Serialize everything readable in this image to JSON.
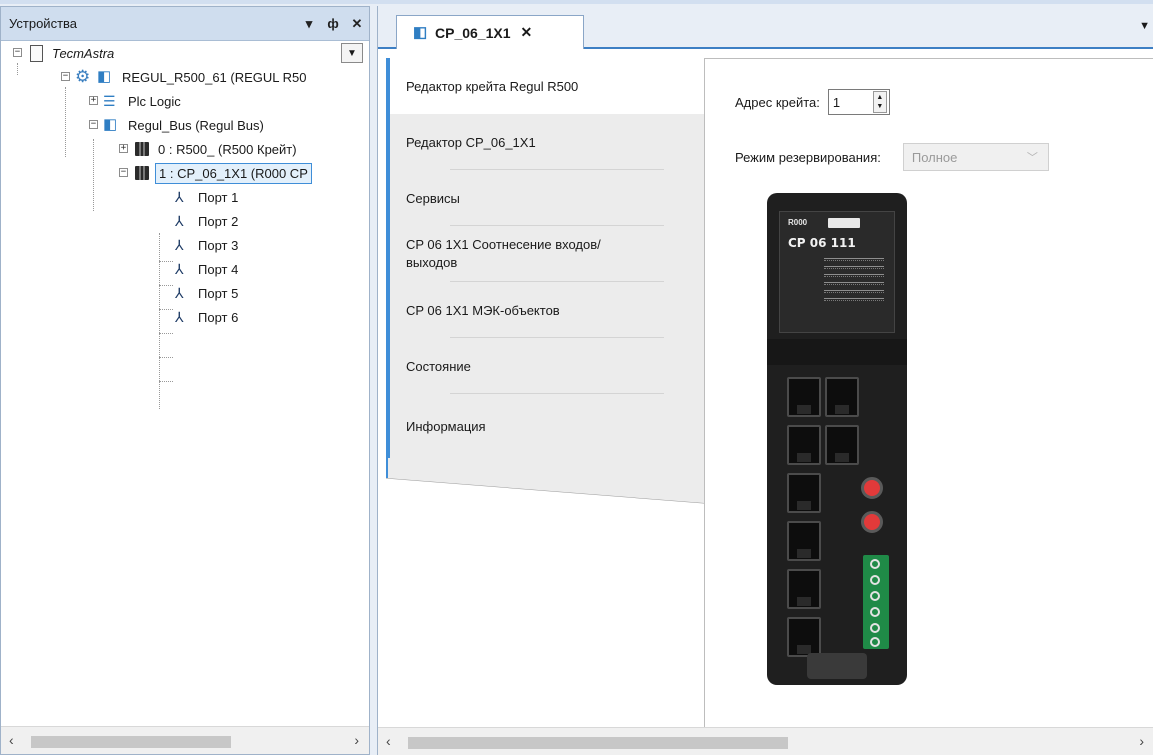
{
  "devices_panel": {
    "title": "Устройства",
    "header_buttons": {
      "dropdown": "▾",
      "pin": "ф",
      "close": "✕"
    },
    "tree": [
      {
        "label": "ТестAstra",
        "expander": "−"
      },
      {
        "label": "REGUL_R500_61 (REGUL R50",
        "expander": "−"
      },
      {
        "label": "Plc Logic",
        "expander": "+"
      },
      {
        "label": "Regul_Bus (Regul Bus)",
        "expander": "−"
      },
      {
        "label": "0 : R500_ (R500 Крейт)",
        "expander": "+"
      },
      {
        "label": "1 : CP_06_1X1 (R000 CP",
        "expander": "−"
      },
      {
        "label": "Порт 1"
      },
      {
        "label": "Порт 2"
      },
      {
        "label": "Порт 3"
      },
      {
        "label": "Порт 4"
      },
      {
        "label": "Порт 5"
      },
      {
        "label": "Порт 6"
      }
    ]
  },
  "editor": {
    "tab_title": "CP_06_1X1",
    "tab_close": "✕",
    "nav": [
      "Редактор крейта Regul R500",
      "Редактор CP_06_1X1",
      "Сервисы",
      "CP 06 1X1 Соотнесение входов/выходов",
      "CP 06 1X1 МЭК-объектов",
      "Состояние",
      "Информация"
    ],
    "crate_address_label": "Адрес крейта:",
    "crate_address_value": "1",
    "redundancy_label": "Режим резервирования:",
    "redundancy_value": "Полное",
    "module_image": {
      "model_small": "R000",
      "model_big": "CP 06 111"
    }
  },
  "colors": {
    "accent": "#3f8ed8",
    "panel_header": "#cfddee"
  }
}
